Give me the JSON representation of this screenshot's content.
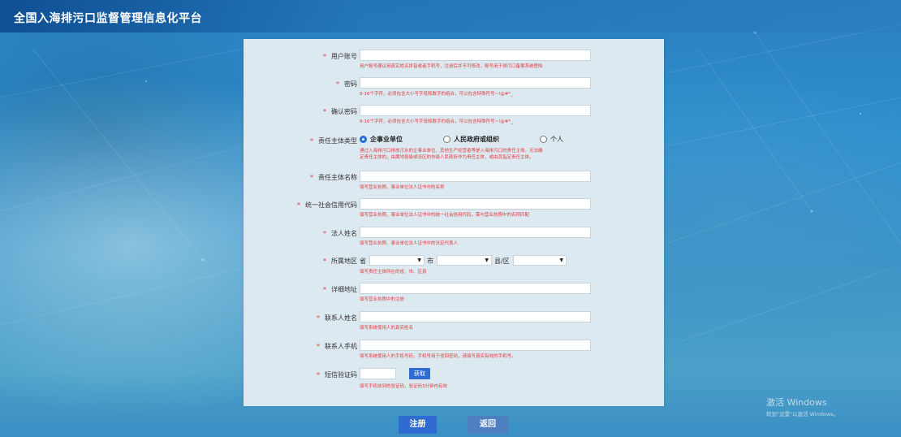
{
  "app_title": "全国入海排污口监督管理信息化平台",
  "required_mark": "*",
  "fields": {
    "account": {
      "label": "用户账号",
      "hint": "用户账号建议用真实姓名拼音或者手机号，注册后并不可修改，账号用于排污口备案系统登陆"
    },
    "password": {
      "label": "密码",
      "hint": "8-16个字符，必须包含大小写字母和数字的组合，可以包含特殊符号~!@#*_"
    },
    "confirm_password": {
      "label": "确认密码",
      "hint": "8-16个字符，必须包含大小写字母和数字的组合，可以包含特殊符号~!@#*_"
    },
    "subject_type": {
      "label": "责任主体类型",
      "options": [
        "企事业单位",
        "人民政府或组织",
        "个人"
      ],
      "selected": "企事业单位",
      "hint_line1": "通过入海排污口排放污水的企事业单位、其他生产经营者等是入海排污口的责任主体。无法确",
      "hint_line2": "定责任主体的，由属地县级或设区的市级人民政府作为责任主体，或由其指定责任主体。"
    },
    "subject_name": {
      "label": "责任主体名称",
      "hint": "填写营业执照、事业单位法人证书中的名称"
    },
    "credit_code": {
      "label": "统一社会信用代码",
      "hint": "填写营业执照、事业单位法人证书中的统一社会信用代码，需与营业执照中的名称匹配"
    },
    "legal_person": {
      "label": "法人姓名",
      "hint": "填写营业执照、事业单位法人证书中的法定代表人"
    },
    "region": {
      "label": "所属地区",
      "province": "省",
      "city": "市",
      "county": "县/区",
      "hint": "填写责任主体所在的省、市、区县"
    },
    "address": {
      "label": "详细地址",
      "hint": "填写营业执照中的注册"
    },
    "contact_name": {
      "label": "联系人姓名",
      "hint": "填写系统使用人的真实姓名"
    },
    "contact_phone": {
      "label": "联系人手机",
      "hint": "填写系统使用人的手机号码，手机号用于找回密码，请填写真实有效的手机号。"
    },
    "sms_code": {
      "label": "短信验证码",
      "button": "获取",
      "hint": "填写手机收到的验证码，验证码3分钟内有效"
    }
  },
  "buttons": {
    "register": "注册",
    "back": "返回"
  },
  "watermark": {
    "line1": "激活 Windows",
    "line2": "转到\"设置\"以激活 Windows。"
  },
  "colors": {
    "primary": "#2f6bd0",
    "hint": "#e03c3c",
    "panel": "#dde9f1"
  }
}
